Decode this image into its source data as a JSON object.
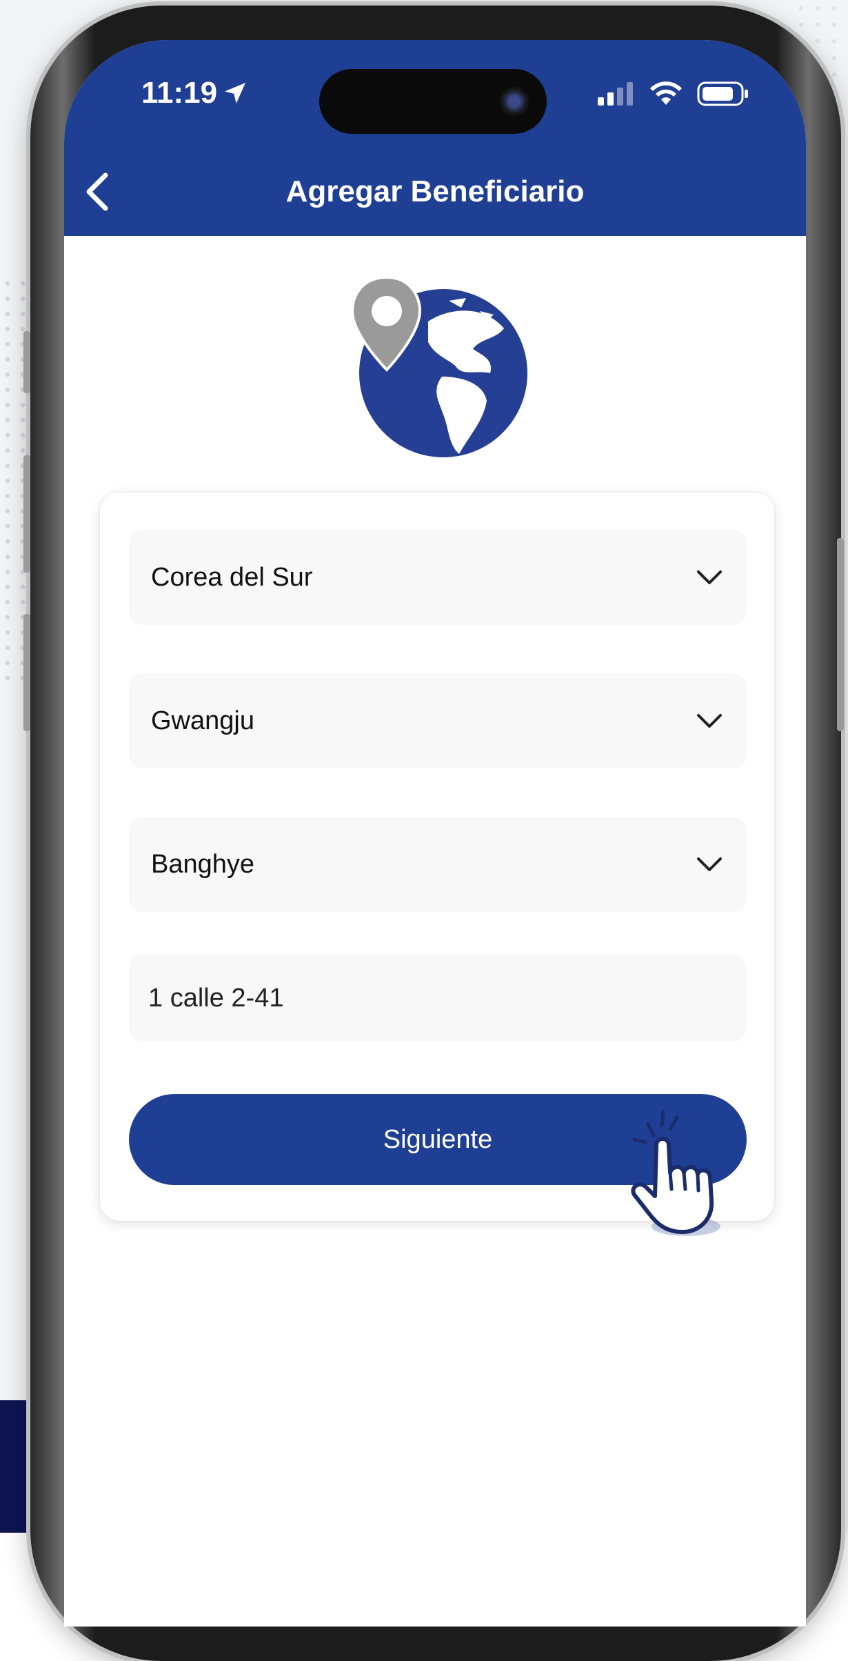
{
  "status_bar": {
    "time": "11:19"
  },
  "header": {
    "title": "Agregar Beneficiario"
  },
  "form": {
    "country": "Corea del Sur",
    "city": "Gwangju",
    "district": "Banghye",
    "address": "1 calle 2-41",
    "submit_label": "Siguiente"
  },
  "colors": {
    "primary": "#1f3f95",
    "field_bg": "#f8f8f8",
    "pin": "#9a9a9a"
  },
  "icons": {
    "back": "chevron-left-icon",
    "dropdown": "chevron-down-icon",
    "illustration": "globe-location-pin-icon",
    "cursor": "hand-pointer-icon"
  }
}
